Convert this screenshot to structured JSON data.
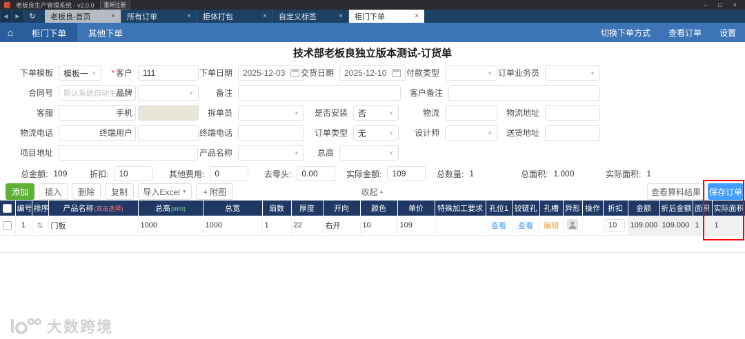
{
  "icons": {
    "back": "◀",
    "forward": "▶",
    "refresh": "↻",
    "close_tab": "×",
    "home": "⌂",
    "caret_down": "▼",
    "collapse_caret": "▲",
    "sort": "⇅",
    "minimize": "–",
    "maximize": "□",
    "close_window": "×"
  },
  "titlebar": {
    "title": "老板良生产管理系统 - v2.0.0",
    "reregister_label": "重新注册"
  },
  "tabbar": {
    "tabs": [
      {
        "label": "老板良-首页"
      },
      {
        "label": "所有订单"
      },
      {
        "label": "柜体打包"
      },
      {
        "label": "自定义标签"
      },
      {
        "label": "柜门下单"
      }
    ]
  },
  "navbar": {
    "active_item": "柜门下单",
    "secondary_item": "其他下单",
    "actions": [
      "切换下单方式",
      "查看订单",
      "设置"
    ]
  },
  "page_title": "技术部老板良独立版本测试-订货单",
  "form": {
    "template": {
      "label": "下单模板",
      "value": "模板一"
    },
    "customer": {
      "label": "客户",
      "value": "111",
      "required_mark": "*"
    },
    "order_date": {
      "label": "下单日期",
      "value": "2025-12-03"
    },
    "delivery_date": {
      "label": "交货日期",
      "value": "2025-12-10"
    },
    "pay_type": {
      "label": "付款类型",
      "value": ""
    },
    "salesman": {
      "label": "订单业务员",
      "value": ""
    },
    "contract_no": {
      "label": "合同号",
      "placeholder": "默认系统自动生成"
    },
    "brand": {
      "label": "品牌",
      "value": ""
    },
    "remark": {
      "label": "备注",
      "value": ""
    },
    "customer_remark": {
      "label": "客户备注",
      "value": ""
    },
    "service": {
      "label": "客服",
      "value": ""
    },
    "phone": {
      "label": "手机",
      "value": ""
    },
    "splitter": {
      "label": "拆单员",
      "value": ""
    },
    "install": {
      "label": "是否安装",
      "value": "否"
    },
    "logistics": {
      "label": "物流",
      "value": ""
    },
    "logistics_addr": {
      "label": "物流地址",
      "value": ""
    },
    "logistics_phone": {
      "label": "物流电话",
      "value": ""
    },
    "end_user": {
      "label": "终端用户",
      "value": ""
    },
    "end_phone": {
      "label": "终端电话",
      "value": ""
    },
    "order_type": {
      "label": "订单类型",
      "value": "无"
    },
    "designer": {
      "label": "设计师",
      "value": ""
    },
    "delivery_addr": {
      "label": "送货地址",
      "value": ""
    },
    "project_addr": {
      "label": "项目地址",
      "value": ""
    },
    "product_name": {
      "label": "产品名称",
      "value": ""
    },
    "total_height": {
      "label": "总高",
      "value": ""
    }
  },
  "summary": {
    "total_amount": {
      "label": "总金额:",
      "value": "109"
    },
    "discount": {
      "label": "折扣:",
      "value": "10"
    },
    "other_fee": {
      "label": "其他费用:",
      "value": "0"
    },
    "rounding": {
      "label": "去零头:",
      "value": "0.00"
    },
    "actual_amount": {
      "label": "实际金额:",
      "value": "109"
    },
    "total_qty": {
      "label": "总数量:",
      "value": "1"
    },
    "total_area": {
      "label": "总面积:",
      "value": "1.000"
    },
    "actual_area": {
      "label": "实际面积:",
      "value": "1"
    }
  },
  "toolbar": {
    "add": "添加",
    "insert": "插入",
    "delete": "删除",
    "copy": "复制",
    "import_excel": "导入Excel",
    "attach": "+ 附图",
    "collapse": "收起",
    "view_material_result": "查看算料结果",
    "save_order": "保存订单"
  },
  "table": {
    "headers": [
      "编号",
      "排序",
      "产品名称",
      "总高",
      "总宽",
      "扇数",
      "厚度",
      "开向",
      "颜色",
      "单价",
      "特殊加工要求",
      "孔位1",
      "铰链孔",
      "孔槽",
      "异形",
      "操作",
      "折扣",
      "金额",
      "折后金额",
      "面积",
      "实际面积"
    ],
    "product_name_suffix": "(双击选择)",
    "height_suffix": "(mm)",
    "row": {
      "no": "1",
      "name": "门板",
      "height": "1000",
      "width": "1000",
      "fan_count": "1",
      "thickness": "22",
      "open_dir": "右开",
      "color": "10",
      "price": "109",
      "special": "",
      "hole_link": "查看",
      "hinge_link": "查看",
      "slot_link": "编辑",
      "discount": "10",
      "amount": "109.000",
      "amount_after_discount": "109.000",
      "area": "1",
      "actual_area": "1"
    }
  },
  "watermark": "大数跨境",
  "colors": {
    "navbar_blue": "#3d74b5",
    "table_header_navy": "#1f3864",
    "primary_blue": "#409eff",
    "add_green": "#5eb134",
    "annotation_red": "#ff0000"
  }
}
